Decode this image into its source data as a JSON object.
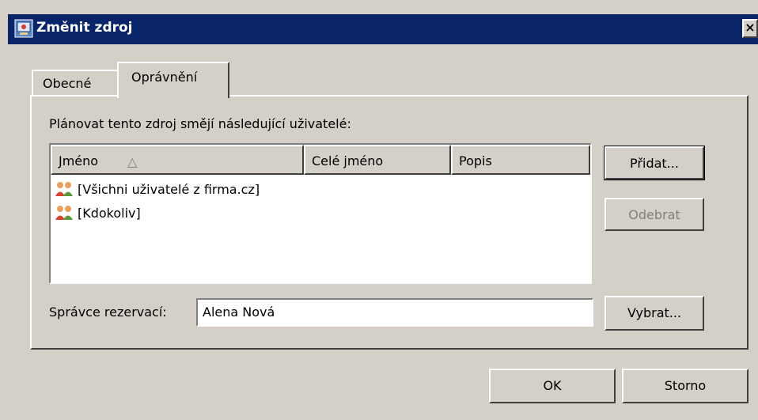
{
  "window": {
    "title": "Změnit zdroj",
    "close_label": "×"
  },
  "tabs": [
    {
      "label": "Obecné"
    },
    {
      "label": "Oprávnění"
    }
  ],
  "permissions": {
    "instruction": "Plánovat tento zdroj smějí následující uživatelé:",
    "columns": [
      "Jméno",
      "Celé jméno",
      "Popis"
    ],
    "sort_indicator": "△",
    "users": [
      {
        "name": "[Všichni uživatelé z firma.cz]",
        "icon": "group-users-icon"
      },
      {
        "name": "[Kdokoliv]",
        "icon": "group-users-icon"
      }
    ],
    "add_label": "Přidat...",
    "remove_label": "Odebrat"
  },
  "manager": {
    "label": "Správce rezervací:",
    "value": "Alena Nová",
    "choose_label": "Vybrat..."
  },
  "footer": {
    "ok_label": "OK",
    "cancel_label": "Storno"
  }
}
